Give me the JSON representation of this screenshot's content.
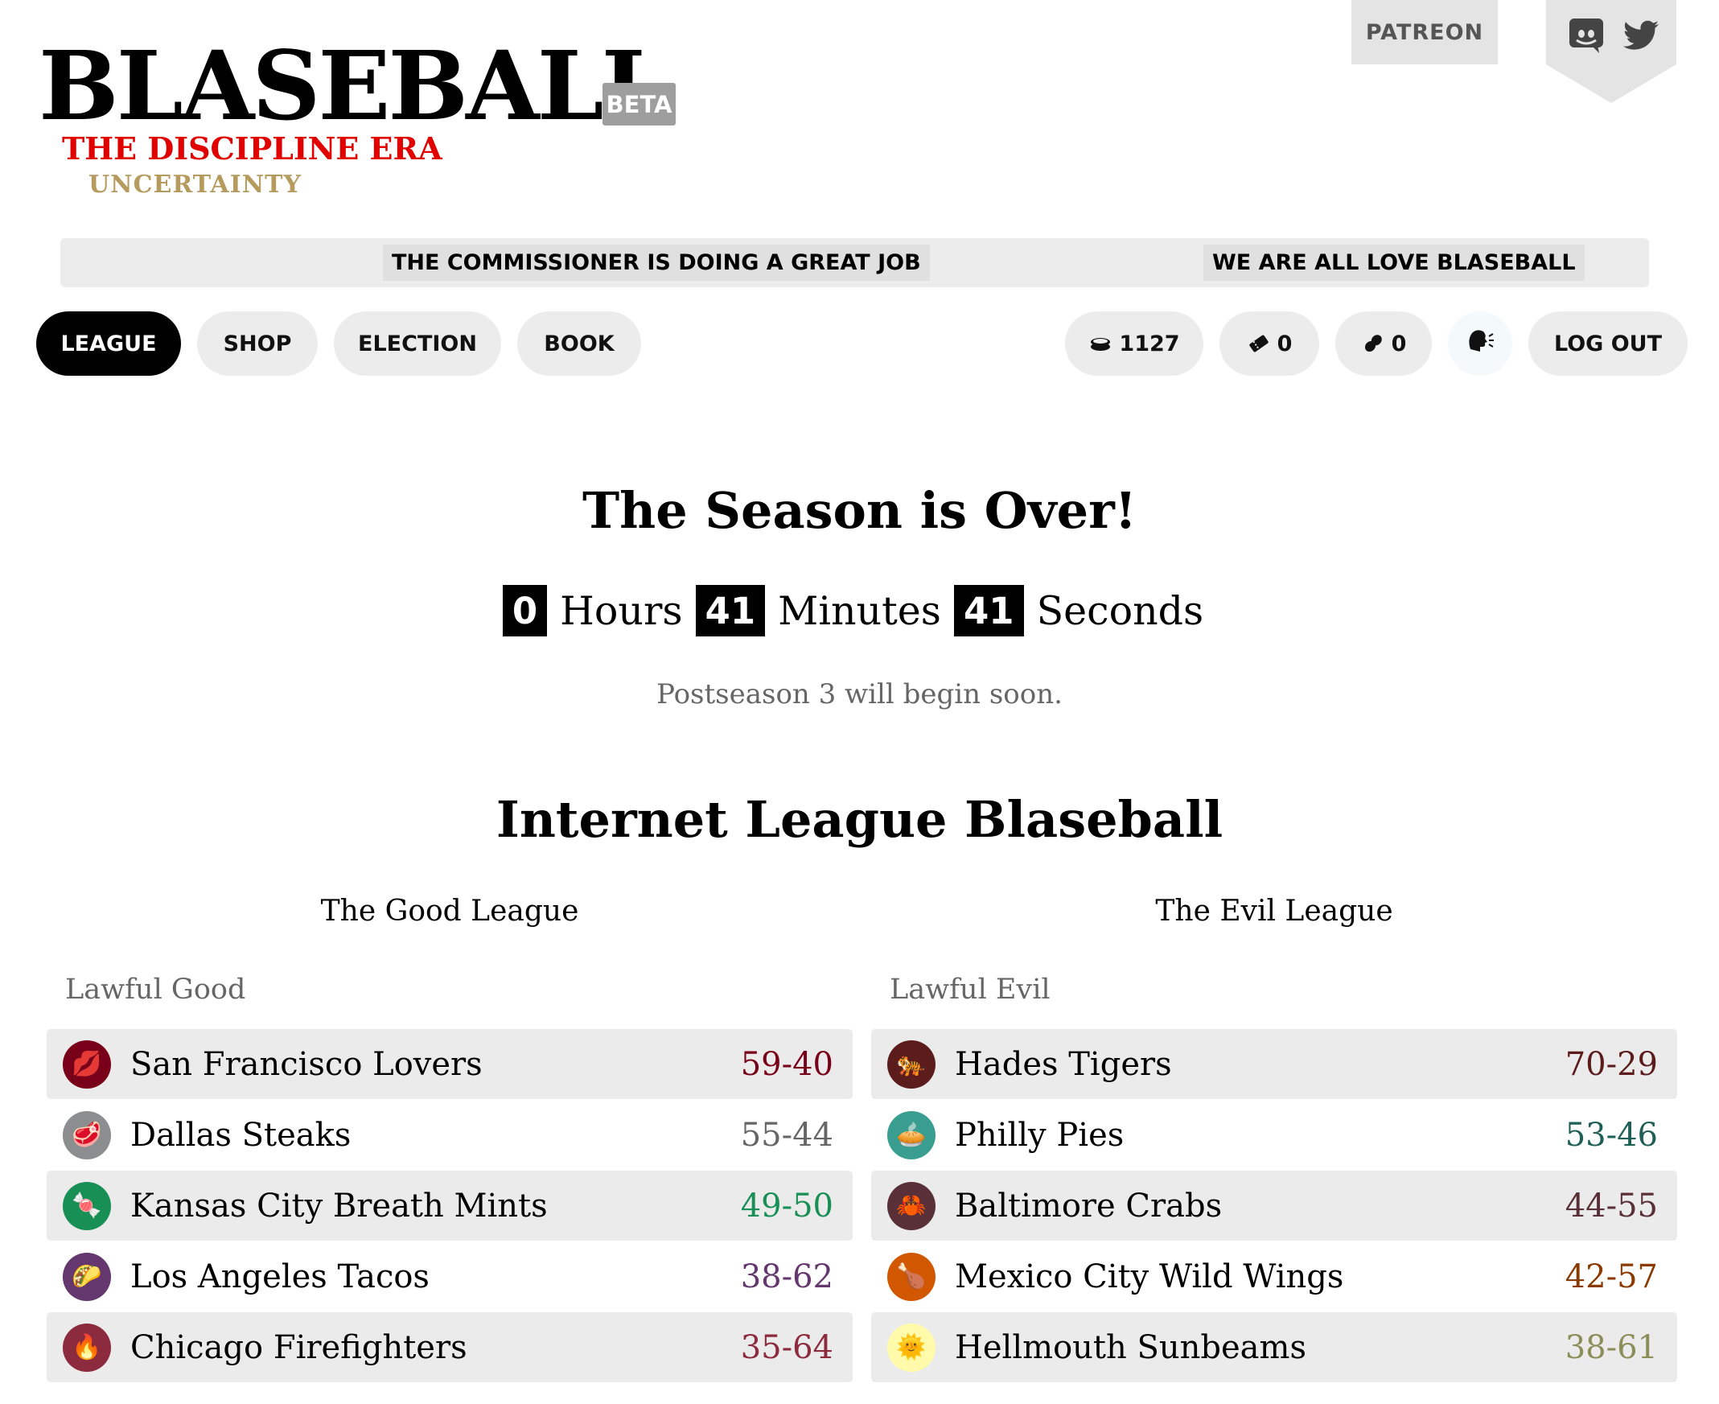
{
  "header": {
    "logo": "BLASEBALL",
    "beta": "BETA",
    "era": "THE DISCIPLINE ERA",
    "era_sub": "UNCERTAINTY",
    "patreon": "PATREON"
  },
  "ticker": [
    "THE COMMISSIONER IS DOING A GREAT JOB",
    "WE ARE ALL LOVE BLASEBALL"
  ],
  "nav": {
    "league": "LEAGUE",
    "shop": "SHOP",
    "election": "ELECTION",
    "book": "BOOK",
    "coins": "1127",
    "votes": "0",
    "peanuts": "0",
    "logout": "LOG OUT"
  },
  "countdown": {
    "title": "The Season is Over!",
    "hours": "0",
    "hours_label": "Hours",
    "minutes": "41",
    "minutes_label": "Minutes",
    "seconds": "41",
    "seconds_label": "Seconds",
    "note": "Postseason 3 will begin soon."
  },
  "league": {
    "title": "Internet League Blaseball",
    "good": {
      "name": "The Good League",
      "division": "Lawful Good",
      "teams": [
        {
          "name": "San Francisco Lovers",
          "record": "59-40",
          "color": "#780018",
          "record_color": "#780018",
          "emoji": "💋"
        },
        {
          "name": "Dallas Steaks",
          "record": "55-44",
          "color": "#8c8d8f",
          "record_color": "#666666",
          "emoji": "🥩"
        },
        {
          "name": "Kansas City Breath Mints",
          "record": "49-50",
          "color": "#178f55",
          "record_color": "#178f55",
          "emoji": "🍬"
        },
        {
          "name": "Los Angeles Tacos",
          "record": "38-62",
          "color": "#64376e",
          "record_color": "#64376e",
          "emoji": "🌮"
        },
        {
          "name": "Chicago Firefighters",
          "record": "35-64",
          "color": "#8c2a3e",
          "record_color": "#8c2a3e",
          "emoji": "🔥"
        }
      ]
    },
    "evil": {
      "name": "The Evil League",
      "division": "Lawful Evil",
      "teams": [
        {
          "name": "Hades Tigers",
          "record": "70-29",
          "color": "#5c1c1c",
          "record_color": "#5c1c1c",
          "emoji": "🐅"
        },
        {
          "name": "Philly Pies",
          "record": "53-46",
          "color": "#399d8f",
          "record_color": "#1f5f55",
          "emoji": "🥧"
        },
        {
          "name": "Baltimore Crabs",
          "record": "44-55",
          "color": "#593037",
          "record_color": "#593037",
          "emoji": "🦀"
        },
        {
          "name": "Mexico City Wild Wings",
          "record": "42-57",
          "color": "#d15700",
          "record_color": "#8a3a00",
          "emoji": "🍗"
        },
        {
          "name": "Hellmouth Sunbeams",
          "record": "38-61",
          "color": "#fffbab",
          "record_color": "#8a8f5a",
          "emoji": "🌞"
        }
      ]
    }
  }
}
